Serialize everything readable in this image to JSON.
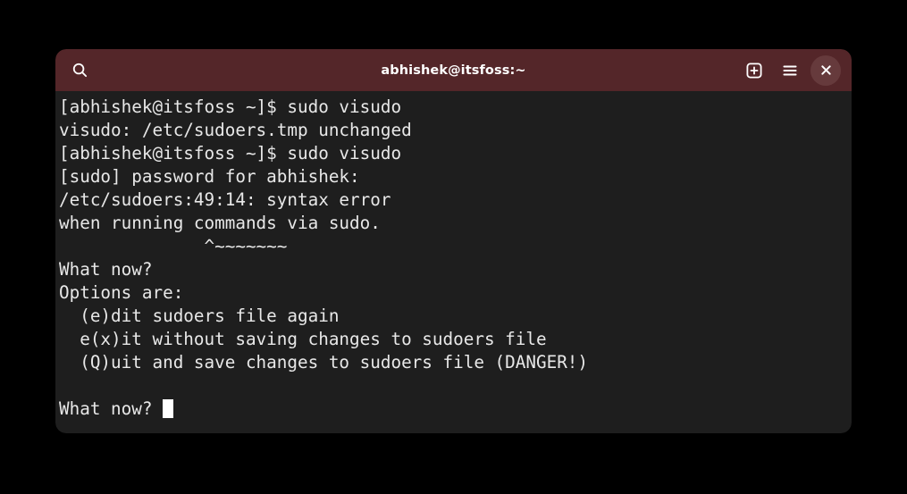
{
  "window": {
    "title": "abhishek@itsfoss:~",
    "titlebar_color": "#542629",
    "terminal_bg": "#1e1e1e",
    "text_color": "#e8e8e8",
    "desktop_bg": "#000000"
  },
  "titlebar": {
    "search_icon": "search-icon",
    "new_tab_icon": "new-tab-icon",
    "menu_icon": "hamburger-menu-icon",
    "close_icon": "close-icon",
    "close_button_bg": "#663a3c"
  },
  "terminal": {
    "lines": [
      "[abhishek@itsfoss ~]$ sudo visudo",
      "visudo: /etc/sudoers.tmp unchanged",
      "[abhishek@itsfoss ~]$ sudo visudo",
      "[sudo] password for abhishek:",
      "/etc/sudoers:49:14: syntax error",
      "when running commands via sudo.",
      "              ^~~~~~~~",
      "What now?",
      "Options are:",
      "  (e)dit sudoers file again",
      "  e(x)it without saving changes to sudoers file",
      "  (Q)uit and save changes to sudoers file (DANGER!)",
      ""
    ],
    "prompt_line": "What now? ",
    "cursor": "block-cursor"
  }
}
